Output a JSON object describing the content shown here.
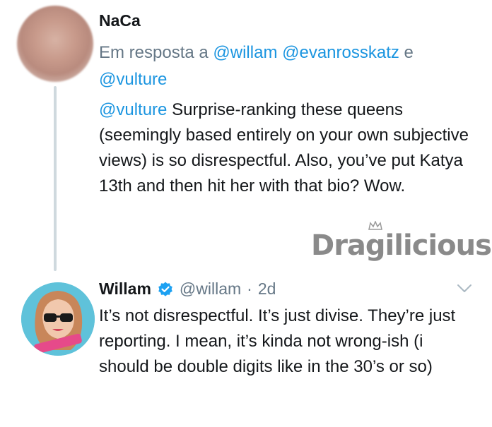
{
  "tweet1": {
    "name": "NaCa",
    "reply_prefix": "Em resposta a",
    "mentions": [
      "@willam",
      "@evanrosskatz",
      "@vulture"
    ],
    "conjunction": "e",
    "body_mention": "@vulture",
    "body_text": "Surprise-ranking these queens (seemingly based entirely on your own subjective views) is so disrespectful. Also, you’ve put Katya 13th and then hit her with that bio? Wow."
  },
  "tweet2": {
    "name": "Willam",
    "handle": "@willam",
    "separator": "·",
    "time": "2d",
    "body_text": "It’s not disrespectful. It’s just divise. They’re just reporting. I mean, it’s kinda not wrong-ish (i should be double digits like in the 30’s or so)"
  },
  "watermark": "Dragilicious",
  "colors": {
    "link": "#1b95e0",
    "muted": "#657786",
    "text": "#14171a",
    "thread_line": "#cfd9de"
  },
  "icons": [
    "verified-badge-icon",
    "chevron-down-icon"
  ]
}
